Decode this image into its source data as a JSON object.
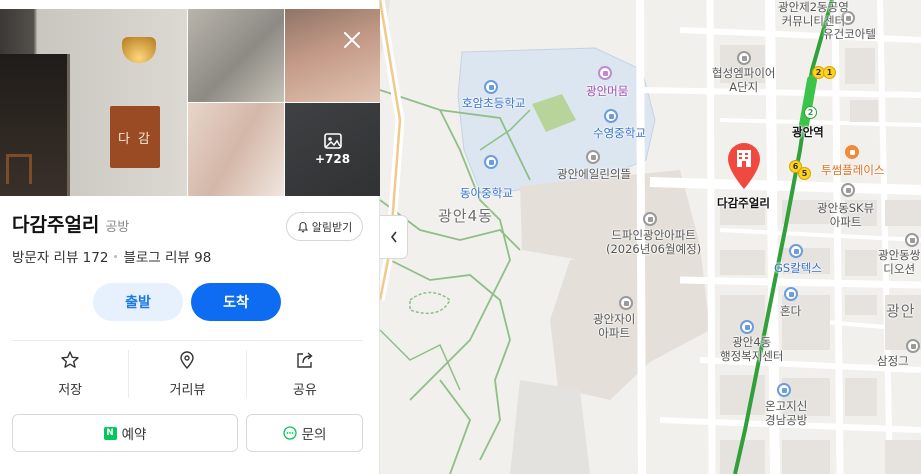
{
  "panel": {
    "photo_more": "+728",
    "sign_text": "다 감",
    "place_name": "다감주얼리",
    "category": "공방",
    "notify_label": "알림받기",
    "visitor_reviews": "방문자 리뷰 172",
    "blog_reviews": "블로그 리뷰 98",
    "depart_label": "출발",
    "arrive_label": "도착",
    "actions": {
      "save": "저장",
      "streetview": "거리뷰",
      "share": "공유"
    },
    "reserve_label": "예약",
    "reserve_badge": "N",
    "inquiry_label": "문의"
  },
  "map": {
    "labels": {
      "community_center": "광안제2동공영\n커뮤니티센터",
      "yugeon": "유건코아텔",
      "hyupsung": "협성엠파이어\nA단지",
      "hoam": "호암초등학교",
      "gwangan_meoreum": "광안머뭄",
      "suyeong_middle": "수영중학교",
      "gwangan_station": "광안역",
      "gwangan_elim": "광안에일린의뜰",
      "dongah_middle": "동아중학교",
      "gwangan4_big": "광안4동",
      "target_place": "다감주얼리",
      "twosome": "투썸플레이스",
      "skview": "광안동SK뷰\n아파트",
      "dfine": "드파인광안아파트\n(2026년06월예정)",
      "dongssang": "광안동쌍\n디오션",
      "gs_caltex": "GS칼텍스",
      "honda": "혼다",
      "gwangan_zai": "광안자이\n아파트",
      "gwangan_right": "광안",
      "admin_center": "광안4동\n행정복지센터",
      "samjeong": "삼정그",
      "ongoji": "온고지신\n경남공방"
    },
    "subway": {
      "line1": "1",
      "line2": "2",
      "line5": "5",
      "line6": "6"
    }
  }
}
